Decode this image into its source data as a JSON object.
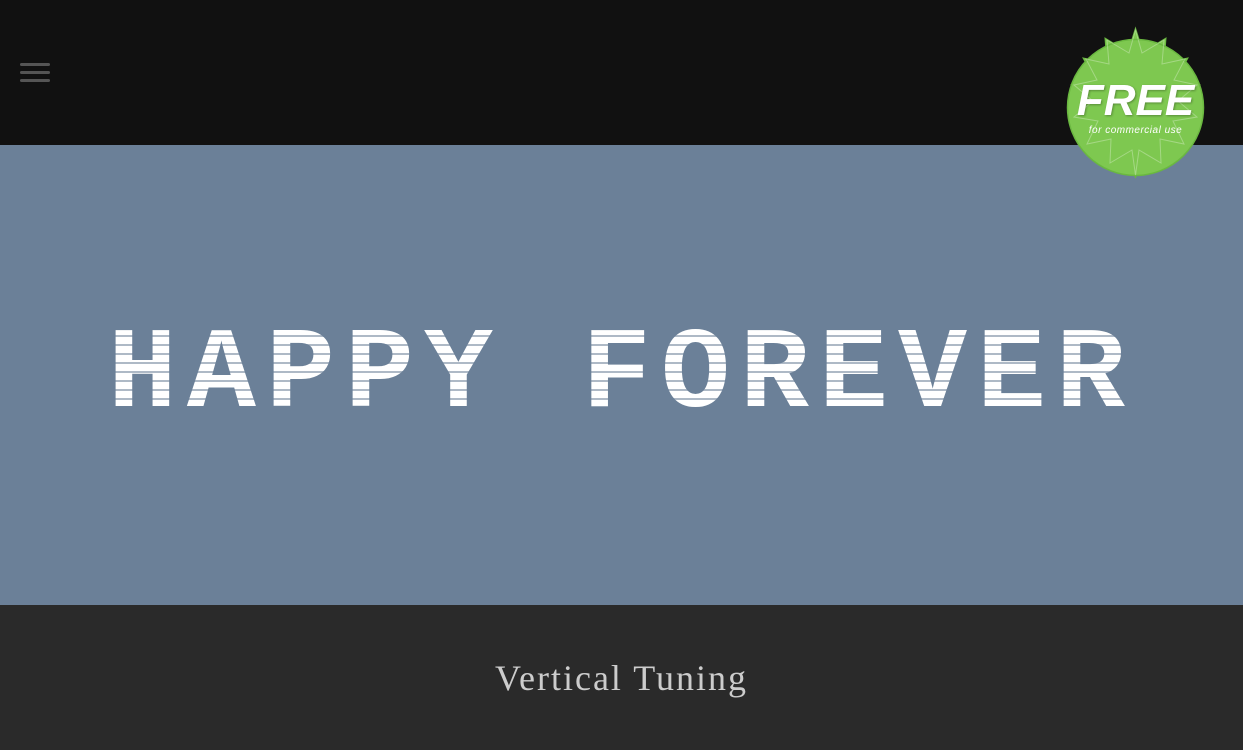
{
  "topBar": {
    "background": "#111111",
    "icons": [
      "menu-line-1",
      "menu-line-2"
    ]
  },
  "mainContent": {
    "background": "#6b8098",
    "previewText": "HAPPY FOREVER",
    "textColor": "#ffffff"
  },
  "bottomBar": {
    "background": "#2a2a2a",
    "fontName": "Vertical Tuning"
  },
  "badge": {
    "backgroundColor": "#7ec850",
    "freeLabel": "FREE",
    "commercialLabel": "for commercial use"
  }
}
